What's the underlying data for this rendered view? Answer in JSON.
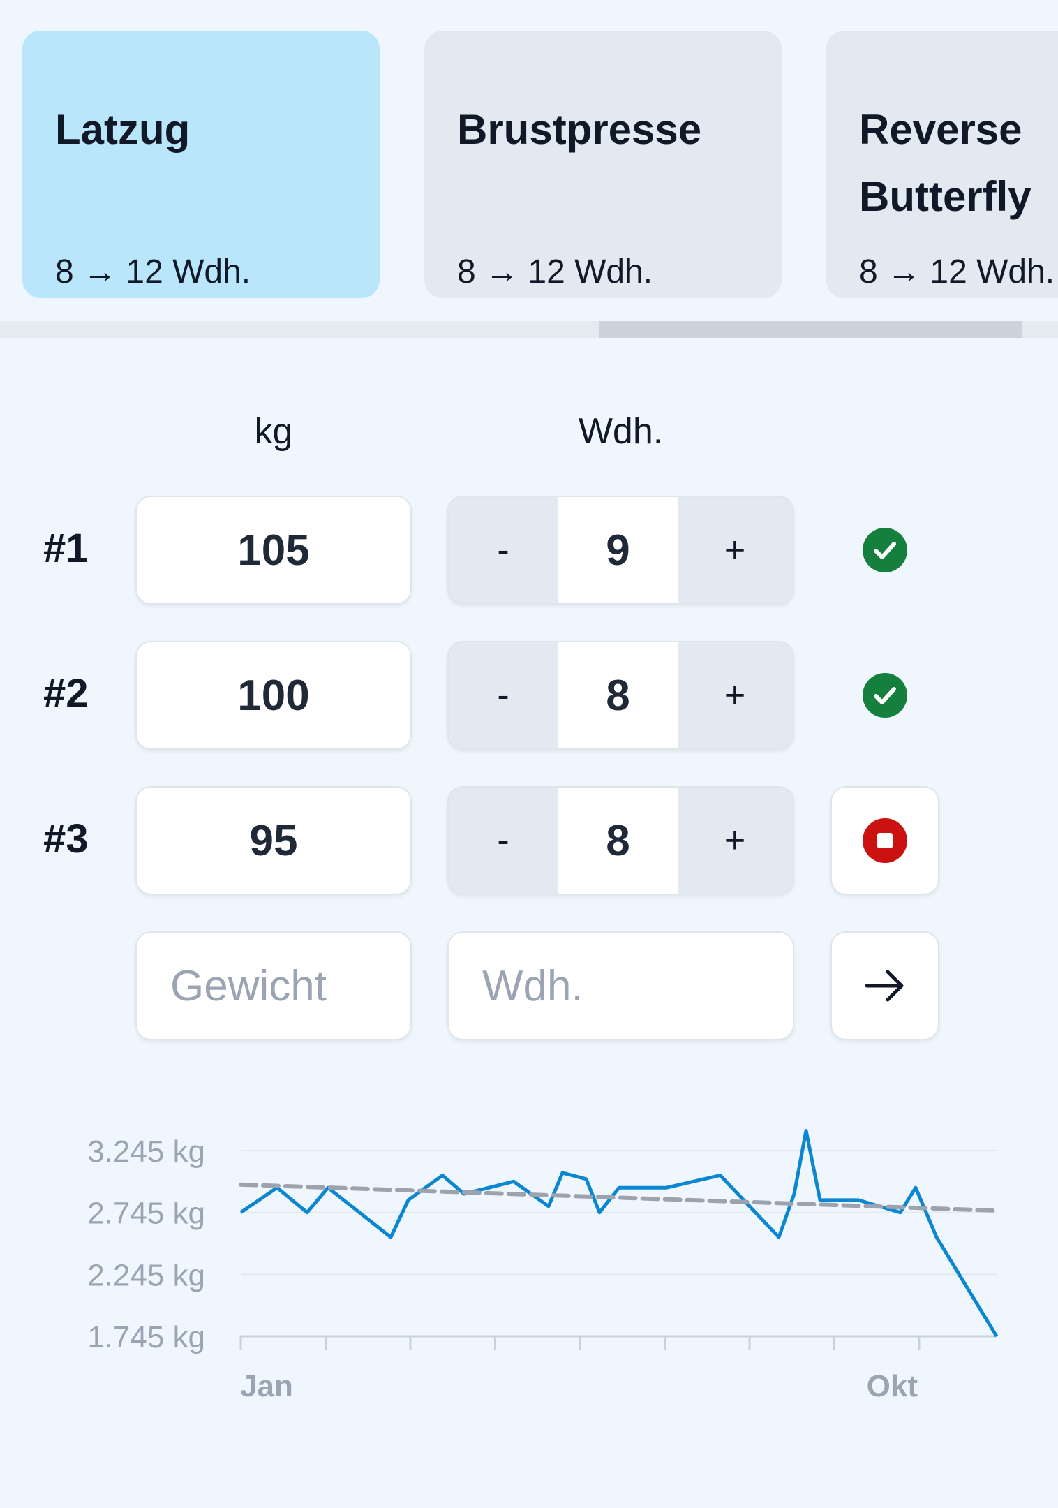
{
  "exercises": [
    {
      "name": "Latzug",
      "range": "8 → 12 Wdh.",
      "active": true
    },
    {
      "name": "Brustpresse",
      "range": "8 → 12 Wdh.",
      "active": false
    },
    {
      "name": "Reverse Butterfly",
      "range": "8 → 12 Wdh.",
      "active": false
    }
  ],
  "columns": {
    "weight": "kg",
    "reps": "Wdh."
  },
  "sets": [
    {
      "label": "#1",
      "weight": "105",
      "reps": "9",
      "minus": "-",
      "plus": "+",
      "status": "done"
    },
    {
      "label": "#2",
      "weight": "100",
      "reps": "8",
      "minus": "-",
      "plus": "+",
      "status": "done"
    },
    {
      "label": "#3",
      "weight": "95",
      "reps": "8",
      "minus": "-",
      "plus": "+",
      "status": "stop"
    }
  ],
  "new_set": {
    "weight_placeholder": "Gewicht",
    "reps_placeholder": "Wdh."
  },
  "icons": {
    "done": "check-circle-icon",
    "stop": "stop-circle-icon",
    "submit": "arrow-right-icon"
  },
  "colors": {
    "accent_card": "#bae6fc",
    "done_green": "#15803d",
    "stop_red": "#cc1111",
    "line_blue": "#0b87d1",
    "trend_gray": "#9ca3af"
  },
  "chart_data": {
    "type": "line",
    "y_tick_labels": [
      "3.245 kg",
      "2.745 kg",
      "2.245 kg",
      "1.745 kg"
    ],
    "y_ticks": [
      3245,
      2745,
      2245,
      1745
    ],
    "ylim": [
      1745,
      3245
    ],
    "x_tick_labels": [
      "Jan",
      "Okt"
    ],
    "series": [
      {
        "values": [
          2745,
          2945,
          2745,
          2945,
          2545,
          2845,
          3045,
          2895,
          2995,
          2795,
          3065,
          3015,
          2745,
          2945,
          2945,
          3045,
          2545,
          2895,
          3405,
          2845,
          2845,
          2745,
          2945,
          2545,
          1745
        ]
      },
      {
        "style": "dashed",
        "values": [
          2970,
          2760
        ]
      }
    ]
  }
}
